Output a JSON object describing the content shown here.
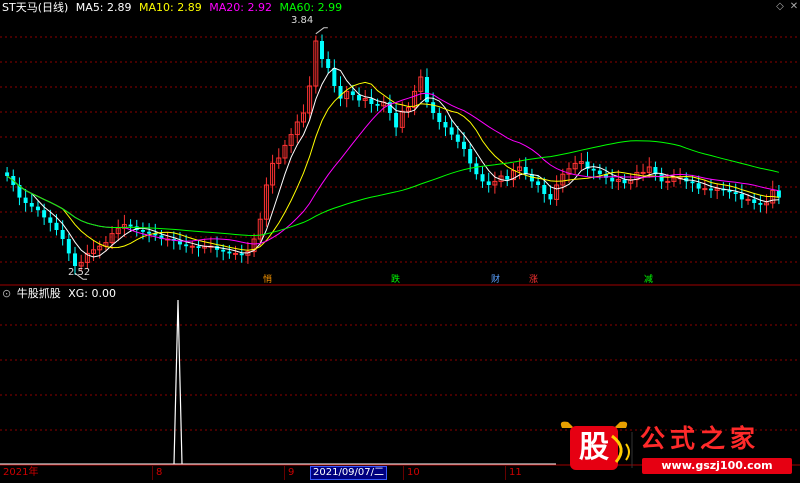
{
  "header": {
    "stock_name": "ST天马(日线)",
    "ma": [
      {
        "label": "MA5: 2.89",
        "color": "#ffffff"
      },
      {
        "label": "MA10: 2.89",
        "color": "#ffff00"
      },
      {
        "label": "MA20: 2.92",
        "color": "#ff00ff"
      },
      {
        "label": "MA60: 2.99",
        "color": "#00ff00"
      }
    ]
  },
  "annotations": {
    "high_label": "3.84",
    "low_label": "2.52"
  },
  "markers": [
    {
      "text": "悄",
      "color": "#ff9900"
    },
    {
      "text": "跌",
      "color": "#00ff00"
    },
    {
      "text": "财",
      "color": "#5aa0ff"
    },
    {
      "text": "涨",
      "color": "#ff3333"
    },
    {
      "text": "减",
      "color": "#00ff00"
    }
  ],
  "indicator": {
    "title": "牛股抓股",
    "value_label": "XG: 0.00"
  },
  "xaxis": {
    "start": "2021年",
    "labels": [
      "8",
      "9",
      "10",
      "11"
    ],
    "cursor_date": "2021/09/07/二"
  },
  "watermark": {
    "badge": "股",
    "site_title": "公式之家",
    "url": "www.gszj100.com"
  },
  "colors": {
    "up": "#ff3333",
    "down": "#00ffff",
    "grid": "#8b0000",
    "ma5": "#ffffff",
    "ma10": "#ffff00",
    "ma20": "#ff00ff",
    "ma60": "#00ff00"
  },
  "chart_data": {
    "type": "candlestick",
    "ohlc_approx_close": [
      3.05,
      3.0,
      2.93,
      2.9,
      2.88,
      2.86,
      2.82,
      2.79,
      2.75,
      2.7,
      2.62,
      2.55,
      2.57,
      2.62,
      2.64,
      2.66,
      2.68,
      2.73,
      2.76,
      2.78,
      2.77,
      2.75,
      2.74,
      2.73,
      2.72,
      2.7,
      2.7,
      2.69,
      2.67,
      2.66,
      2.66,
      2.65,
      2.66,
      2.66,
      2.64,
      2.63,
      2.62,
      2.62,
      2.61,
      2.63,
      2.7,
      2.81,
      3.0,
      3.12,
      3.15,
      3.22,
      3.28,
      3.35,
      3.4,
      3.55,
      3.8,
      3.7,
      3.65,
      3.55,
      3.48,
      3.52,
      3.5,
      3.47,
      3.48,
      3.45,
      3.44,
      3.46,
      3.4,
      3.32,
      3.41,
      3.43,
      3.52,
      3.6,
      3.46,
      3.4,
      3.35,
      3.32,
      3.28,
      3.24,
      3.2,
      3.12,
      3.06,
      3.02,
      3.0,
      3.02,
      3.05,
      3.03,
      3.08,
      3.1,
      3.06,
      3.02,
      3.0,
      2.95,
      2.92,
      3.0,
      3.06,
      3.09,
      3.12,
      3.13,
      3.09,
      3.08,
      3.06,
      3.04,
      3.02,
      3.03,
      3.01,
      3.03,
      3.07,
      3.07,
      3.1,
      3.06,
      3.02,
      3.02,
      3.04,
      3.04,
      3.02,
      3.01,
      2.98,
      2.98,
      2.97,
      2.98,
      2.97,
      2.96,
      2.95,
      2.92,
      2.92,
      2.9,
      2.89,
      2.9,
      2.97,
      2.93
    ],
    "xg_signal": [
      0,
      0,
      0,
      0,
      0,
      0,
      0,
      0,
      0,
      0,
      0,
      0,
      0,
      0,
      0,
      0,
      0,
      0,
      0,
      0,
      0,
      0,
      0,
      0,
      0,
      0,
      0,
      0,
      0,
      0,
      0,
      0,
      0,
      0,
      0,
      0,
      0,
      0,
      1,
      0,
      0,
      0,
      0,
      0,
      0,
      0,
      0,
      0,
      0,
      0,
      0,
      0,
      0,
      0,
      0,
      0,
      0,
      0,
      0,
      0,
      0,
      0,
      0,
      0,
      0,
      0,
      0,
      0,
      0,
      0,
      0,
      0,
      0,
      0,
      0,
      0,
      0,
      0,
      0,
      0,
      0,
      0,
      0,
      0,
      0,
      0,
      0,
      0,
      0,
      0,
      0,
      0,
      0,
      0,
      0,
      0,
      0,
      0,
      0,
      0,
      0,
      0,
      0,
      0,
      0,
      0,
      0,
      0,
      0,
      0,
      0,
      0,
      0,
      0,
      0,
      0,
      0,
      0,
      0,
      0,
      0,
      0,
      0,
      0,
      0
    ],
    "ylim": [
      2.45,
      3.95
    ]
  }
}
